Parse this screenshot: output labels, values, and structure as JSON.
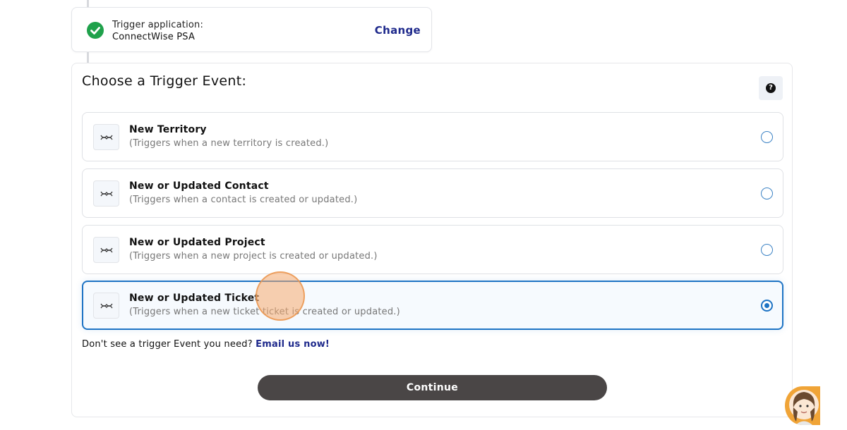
{
  "trigger_app": {
    "label": "Trigger application:",
    "name": "ConnectWise PSA",
    "change_label": "Change",
    "status_icon": "check-circle-icon",
    "status_color": "#1fa14b"
  },
  "trigger_event": {
    "title": "Choose a Trigger Event:",
    "help_icon": "question-icon",
    "options": [
      {
        "title": "New Territory",
        "description": "(Triggers when a new territory is created.)",
        "selected": false
      },
      {
        "title": "New or Updated Contact",
        "description": "(Triggers when a contact is created or updated.)",
        "selected": false
      },
      {
        "title": "New or Updated Project",
        "description": "(Triggers when a new project is created or updated.)",
        "selected": false
      },
      {
        "title": "New or Updated Ticket",
        "description": "(Triggers when a new ticket ticket is created or updated.)",
        "selected": true
      }
    ],
    "missing_text": "Don't see a trigger Event you need?",
    "missing_link": "Email us now!",
    "continue_label": "Continue"
  },
  "colors": {
    "accent": "#1d73c4",
    "link": "#1f2a8c",
    "button": "#4a4646"
  }
}
